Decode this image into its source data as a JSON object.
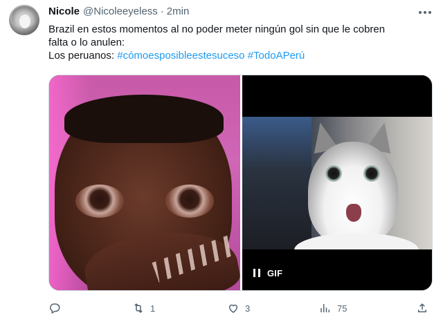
{
  "tweet": {
    "author": {
      "name": "Nicole",
      "handle": "@Nicoleeyeless",
      "separator": "·",
      "time": "2min"
    },
    "text": {
      "line1": "Brazil en estos momentos al no poder meter ningún gol sin que le cobren",
      "line2": "falta o lo anulen:",
      "line3_prefix": "Los peruanos: ",
      "hashtag1": "#cómoesposibleestesuceso",
      "hashtag2": "#TodoAPerú"
    },
    "media": {
      "gif_label": "GIF"
    },
    "actions": {
      "reply_count": "",
      "retweet_count": "1",
      "like_count": "3",
      "views_count": "75"
    },
    "colors": {
      "link": "#1d9bf0",
      "secondary_text": "#536471",
      "primary_text": "#0f1419"
    },
    "icons": [
      "more-icon",
      "reply-icon",
      "retweet-icon",
      "like-icon",
      "views-icon",
      "share-icon",
      "pause-icon"
    ]
  }
}
